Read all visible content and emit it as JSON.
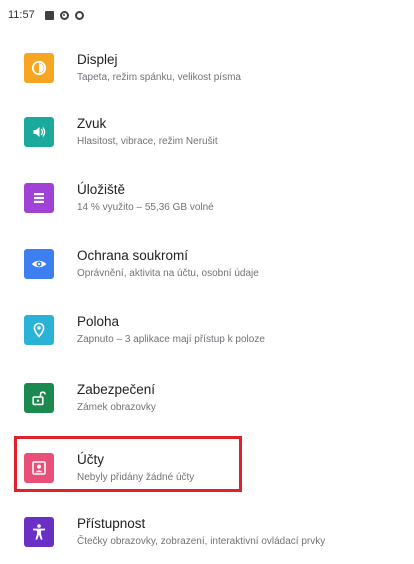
{
  "status_bar": {
    "time": "11:57",
    "icons": [
      "notification-box-icon",
      "gear-icon",
      "ring-icon"
    ]
  },
  "settings": [
    {
      "id": "display",
      "title": "Displej",
      "subtitle": "Tapeta, režim spánku, velikost písma",
      "icon": "display-brightness-icon",
      "color": "#f6a623"
    },
    {
      "id": "sound",
      "title": "Zvuk",
      "subtitle": "Hlasitost, vibrace, režim Nerušit",
      "icon": "speaker-icon",
      "color": "#1aa99b"
    },
    {
      "id": "storage",
      "title": "Úložiště",
      "subtitle": "14 % využito – 55,36 GB volné",
      "icon": "storage-icon",
      "color": "#a142d6"
    },
    {
      "id": "privacy",
      "title": "Ochrana soukromí",
      "subtitle": "Oprávnění, aktivita na účtu, osobní údaje",
      "icon": "privacy-eye-icon",
      "color": "#3d7ef0"
    },
    {
      "id": "location",
      "title": "Poloha",
      "subtitle": "Zapnuto – 3 aplikace mají přístup k poloze",
      "icon": "location-pin-icon",
      "color": "#2ab3d6"
    },
    {
      "id": "security",
      "title": "Zabezpečení",
      "subtitle": "Zámek obrazovky",
      "icon": "padlock-icon",
      "color": "#1b8a4f"
    },
    {
      "id": "accounts",
      "title": "Účty",
      "subtitle": "Nebyly přidány žádné účty",
      "icon": "account-icon",
      "color": "#e8507a"
    },
    {
      "id": "accessibility",
      "title": "Přístupnost",
      "subtitle": "Čtečky obrazovky, zobrazení, interaktivní ovládací prvky",
      "icon": "accessibility-person-icon",
      "color": "#6a2fc4"
    }
  ],
  "highlight": {
    "target": "accounts",
    "color": "#e0222a"
  }
}
